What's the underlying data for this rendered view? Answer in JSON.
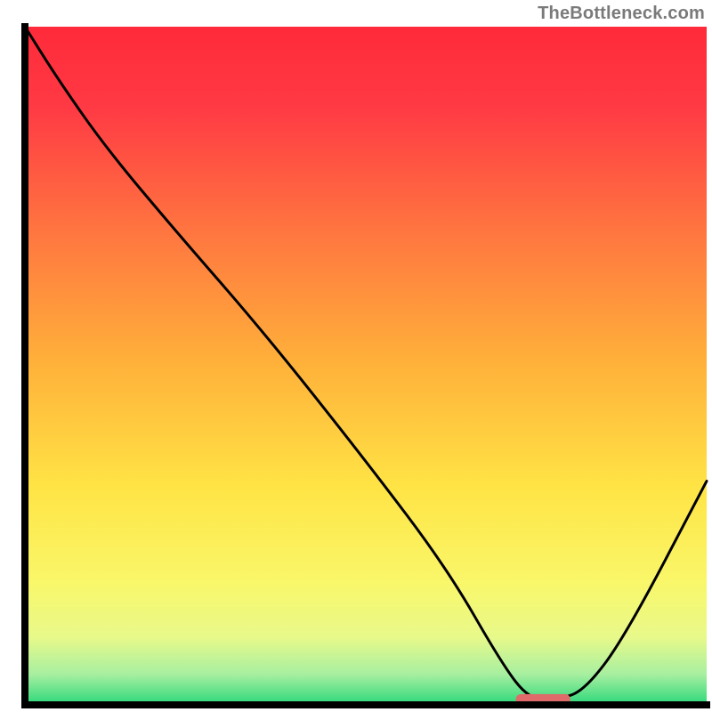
{
  "watermark": "TheBottleneck.com",
  "chart_data": {
    "type": "line",
    "title": "",
    "xlabel": "",
    "ylabel": "",
    "xlim": [
      0,
      100
    ],
    "ylim": [
      0,
      100
    ],
    "x": [
      0,
      5,
      12,
      22,
      35,
      50,
      62,
      70,
      74,
      78,
      82,
      88,
      100
    ],
    "values": [
      100,
      92,
      82,
      70,
      55,
      36,
      20,
      6,
      0.8,
      0.8,
      2,
      10,
      33
    ],
    "optimal_marker": {
      "x_start": 72,
      "x_end": 80,
      "y": 0.8
    },
    "background_gradient": {
      "stops": [
        {
          "offset": 0.0,
          "color": "#ff2a3a"
        },
        {
          "offset": 0.12,
          "color": "#ff3a44"
        },
        {
          "offset": 0.3,
          "color": "#ff7540"
        },
        {
          "offset": 0.5,
          "color": "#ffb23a"
        },
        {
          "offset": 0.68,
          "color": "#ffe445"
        },
        {
          "offset": 0.82,
          "color": "#f9f76a"
        },
        {
          "offset": 0.9,
          "color": "#e8f98a"
        },
        {
          "offset": 0.955,
          "color": "#a7efa0"
        },
        {
          "offset": 1.0,
          "color": "#2bd87a"
        }
      ]
    },
    "curve_color": "#000000",
    "marker_color": "#e06a6a",
    "frame_color": "#000000"
  }
}
